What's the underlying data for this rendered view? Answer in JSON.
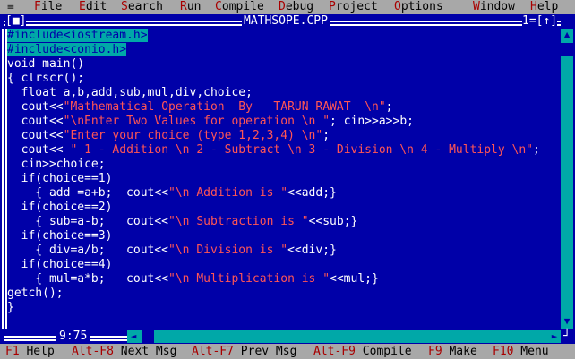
{
  "menubar": {
    "system": "≡",
    "items": [
      {
        "hot": "F",
        "rest": "ile"
      },
      {
        "hot": "E",
        "rest": "dit"
      },
      {
        "hot": "S",
        "rest": "earch"
      },
      {
        "hot": "R",
        "rest": "un"
      },
      {
        "hot": "C",
        "rest": "ompile"
      },
      {
        "hot": "D",
        "rest": "ebug"
      },
      {
        "hot": "P",
        "rest": "roject"
      },
      {
        "hot": "O",
        "rest": "ptions"
      },
      {
        "hot": "W",
        "rest": "indow"
      },
      {
        "hot": "H",
        "rest": "elp"
      }
    ]
  },
  "window": {
    "close_box": "[■]",
    "title": "MATHSOPE.CPP",
    "number": "1=[↑]",
    "cursor": "9:75",
    "scroll_up": "▲",
    "scroll_down": "▼",
    "scroll_left": "◄",
    "scroll_right": "►",
    "corner": "┘"
  },
  "code": [
    {
      "segs": [
        {
          "t": "#include<iostream.h>",
          "c": "sel"
        }
      ]
    },
    {
      "segs": [
        {
          "t": "#include<conio.h>",
          "c": "sel"
        }
      ]
    },
    {
      "segs": [
        {
          "t": "void main()",
          "c": "k"
        }
      ]
    },
    {
      "segs": [
        {
          "t": "{ clrscr();",
          "c": "k"
        }
      ]
    },
    {
      "segs": [
        {
          "t": "  float a,b,add,sub,mul,div,choice;",
          "c": "k"
        }
      ]
    },
    {
      "segs": [
        {
          "t": "  cout<<",
          "c": "k"
        },
        {
          "t": "\"Mathematical Operation  By   TARUN RAWAT  \\n\"",
          "c": "s"
        },
        {
          "t": ";",
          "c": "k"
        }
      ]
    },
    {
      "segs": [
        {
          "t": "  cout<<",
          "c": "k"
        },
        {
          "t": "\"\\nEnter Two Values for operation \\n \"",
          "c": "s"
        },
        {
          "t": "; cin>>a>>b;",
          "c": "k"
        }
      ]
    },
    {
      "segs": [
        {
          "t": "  cout<<",
          "c": "k"
        },
        {
          "t": "\"Enter your choice (type 1,2,3,4) \\n\"",
          "c": "s"
        },
        {
          "t": ";",
          "c": "k"
        }
      ]
    },
    {
      "segs": [
        {
          "t": "  cout<< ",
          "c": "k"
        },
        {
          "t": "\" 1 - Addition \\n 2 - Subtract \\n 3 - Division \\n 4 - Multiply \\n\"",
          "c": "s"
        },
        {
          "t": ";",
          "c": "k"
        }
      ]
    },
    {
      "segs": [
        {
          "t": "  cin>>choice;",
          "c": "k"
        }
      ]
    },
    {
      "segs": [
        {
          "t": "  if(choice==1)",
          "c": "k"
        }
      ]
    },
    {
      "segs": [
        {
          "t": "    { add =a+b;  cout<<",
          "c": "k"
        },
        {
          "t": "\"\\n Addition is \"",
          "c": "s"
        },
        {
          "t": "<<add;}",
          "c": "k"
        }
      ]
    },
    {
      "segs": [
        {
          "t": "  if(choice==2)",
          "c": "k"
        }
      ]
    },
    {
      "segs": [
        {
          "t": "    { sub=a-b;   cout<<",
          "c": "k"
        },
        {
          "t": "\"\\n Subtraction is \"",
          "c": "s"
        },
        {
          "t": "<<sub;}",
          "c": "k"
        }
      ]
    },
    {
      "segs": [
        {
          "t": "  if(choice==3)",
          "c": "k"
        }
      ]
    },
    {
      "segs": [
        {
          "t": "    { div=a/b;   cout<<",
          "c": "k"
        },
        {
          "t": "\"\\n Division is \"",
          "c": "s"
        },
        {
          "t": "<<div;}",
          "c": "k"
        }
      ]
    },
    {
      "segs": [
        {
          "t": "  if(choice==4)",
          "c": "k"
        }
      ]
    },
    {
      "segs": [
        {
          "t": "    { mul=a*b;   cout<<",
          "c": "k"
        },
        {
          "t": "\"\\n Multiplication is \"",
          "c": "s"
        },
        {
          "t": "<<mul;}",
          "c": "k"
        }
      ]
    },
    {
      "segs": [
        {
          "t": "getch();",
          "c": "k"
        }
      ]
    },
    {
      "segs": [
        {
          "t": "}",
          "c": "k"
        }
      ]
    }
  ],
  "statusbar": [
    {
      "hot": "F1",
      "label": " Help"
    },
    {
      "hot": "Alt-F8",
      "label": " Next Msg"
    },
    {
      "hot": "Alt-F7",
      "label": " Prev Msg"
    },
    {
      "hot": "Alt-F9",
      "label": " Compile"
    },
    {
      "hot": "F9",
      "label": " Make"
    },
    {
      "hot": "F10",
      "label": " Menu"
    }
  ],
  "colors": {
    "background": "#0000a8",
    "bar": "#a8a8a8",
    "hotkey": "#a80000",
    "selection": "#00a8a8",
    "string": "#ff5555"
  }
}
